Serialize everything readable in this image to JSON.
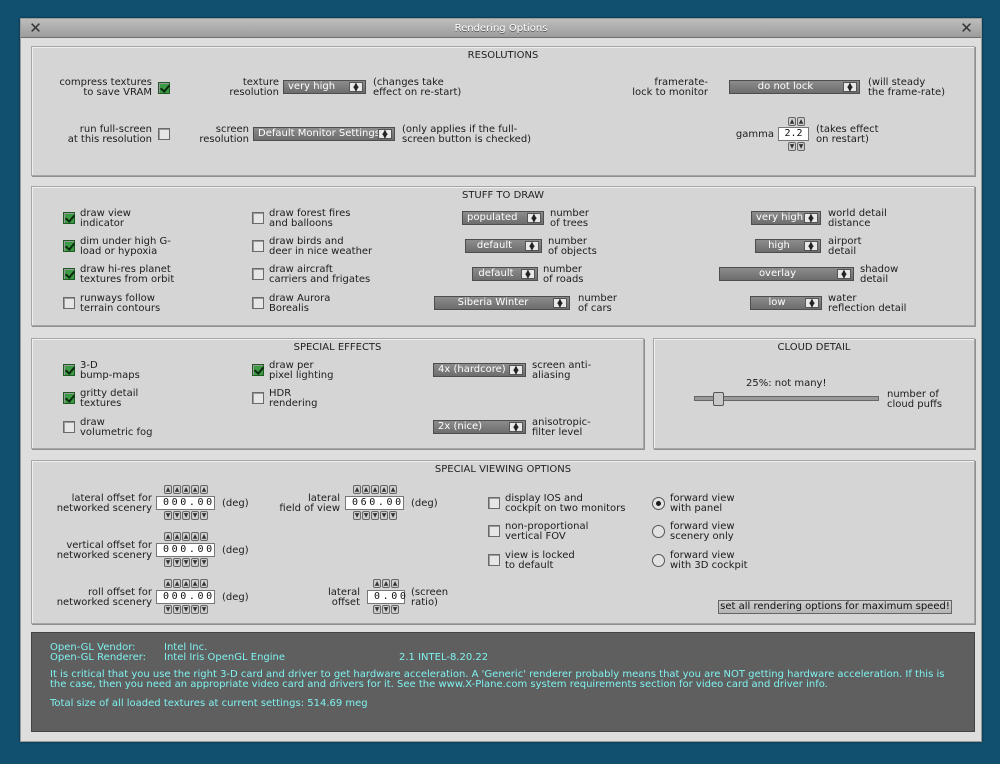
{
  "window": {
    "title": "Rendering Options"
  },
  "resolutions": {
    "title": "RESOLUTIONS",
    "compress_textures_label": "compress textures\nto save VRAM",
    "texture_resolution_label": "texture\nresolution",
    "texture_resolution_value": "very high",
    "texture_note": "(changes take\neffect on re-start)",
    "framerate_label": "framerate-\nlock to monitor",
    "framerate_value": "do not lock",
    "framerate_note": "(will steady\nthe frame-rate)",
    "fullscreen_label": "run full-screen\nat this resolution",
    "screen_resolution_label": "screen\nresolution",
    "screen_resolution_value": "Default Monitor Settings",
    "screen_note": "(only applies if the full-\nscreen button is checked)",
    "gamma_label": "gamma",
    "gamma_value": "2.2",
    "gamma_note": "(takes effect\non restart)"
  },
  "stuff": {
    "title": "STUFF TO DRAW",
    "checkboxes": [
      {
        "label": "draw view\nindicator",
        "checked": true
      },
      {
        "label": "dim under high G-\nload or hypoxia",
        "checked": true
      },
      {
        "label": "draw hi-res planet\ntextures from orbit",
        "checked": true
      },
      {
        "label": "runways follow\nterrain contours",
        "checked": false
      },
      {
        "label": "draw forest fires\nand balloons",
        "checked": false
      },
      {
        "label": "draw birds and\ndeer in nice weather",
        "checked": false
      },
      {
        "label": "draw aircraft\ncarriers and frigates",
        "checked": false
      },
      {
        "label": "draw Aurora\nBorealis",
        "checked": false
      }
    ],
    "trees_value": "populated",
    "trees_label": "number\nof trees",
    "objects_value": "default",
    "objects_label": "number\nof objects",
    "roads_value": "default",
    "roads_label": "number\nof roads",
    "cars_value": "Siberia Winter",
    "cars_label": "number\nof cars",
    "world_value": "very high",
    "world_label": "world detail\ndistance",
    "airport_value": "high",
    "airport_label": "airport\ndetail",
    "shadow_value": "overlay",
    "shadow_label": "shadow\ndetail",
    "water_value": "low",
    "water_label": "water\nreflection detail"
  },
  "effects": {
    "title": "SPECIAL EFFECTS",
    "bump_label": "3-D\nbump-maps",
    "bump_checked": true,
    "gritty_label": "gritty detail\ntextures",
    "gritty_checked": true,
    "fog_label": "draw\nvolumetric fog",
    "fog_checked": false,
    "pixel_label": "draw per\npixel lighting",
    "pixel_checked": true,
    "hdr_label": "HDR\nrendering",
    "hdr_checked": false,
    "aa_value": "4x (hardcore)",
    "aa_label": "screen anti-\naliasing",
    "aniso_value": "2x (nice)",
    "aniso_label": "anisotropic-\nfilter level"
  },
  "cloud": {
    "title": "CLOUD DETAIL",
    "value_text": "25%: not many!",
    "fraction": 0.11,
    "label": "number of\ncloud puffs"
  },
  "viewing": {
    "title": "SPECIAL VIEWING OPTIONS",
    "lateral_offset_label": "lateral offset for\nnetworked scenery",
    "lateral_offset_value": "000.00",
    "lateral_offset_unit": "(deg)",
    "vertical_offset_label": "vertical offset for\nnetworked scenery",
    "vertical_offset_value": "000.00",
    "vertical_offset_unit": "(deg)",
    "roll_offset_label": "roll offset for\nnetworked scenery",
    "roll_offset_value": "000.00",
    "roll_offset_unit": "(deg)",
    "fov_label": "lateral\nfield of view",
    "fov_value": "060.00",
    "fov_unit": "(deg)",
    "lat_offset_label": "lateral\noffset",
    "lat_offset_value": "0.00",
    "lat_offset_unit": "(screen\nratio)",
    "ios_label": "display IOS and\ncockpit on two monitors",
    "nonprop_label": "non-proportional\nvertical FOV",
    "locked_label": "view is locked\nto default",
    "fwd_panel_label": "forward view\nwith panel",
    "fwd_scenery_label": "forward view\nscenery only",
    "fwd_cockpit_label": "forward view\nwith 3D cockpit",
    "max_speed_button": "set all rendering options for maximum speed!"
  },
  "info": {
    "vendor_label": "Open-GL Vendor:",
    "vendor_value": "Intel Inc.",
    "renderer_label": "Open-GL Renderer:",
    "renderer_value": "Intel Iris OpenGL Engine",
    "version": "2.1 INTEL-8.20.22",
    "notice_line1": "It is critical that you use the right 3-D card and driver to get hardware acceleration. A 'Generic' renderer probably means that you are NOT getting hardware acceleration. If this is",
    "notice_line2": "the case, then you need an appropriate video card and drivers for it. See the www.X-Plane.com system requirements section for video card and driver info.",
    "texture_size": "Total size of all loaded textures at current settings: 514.69 meg"
  }
}
